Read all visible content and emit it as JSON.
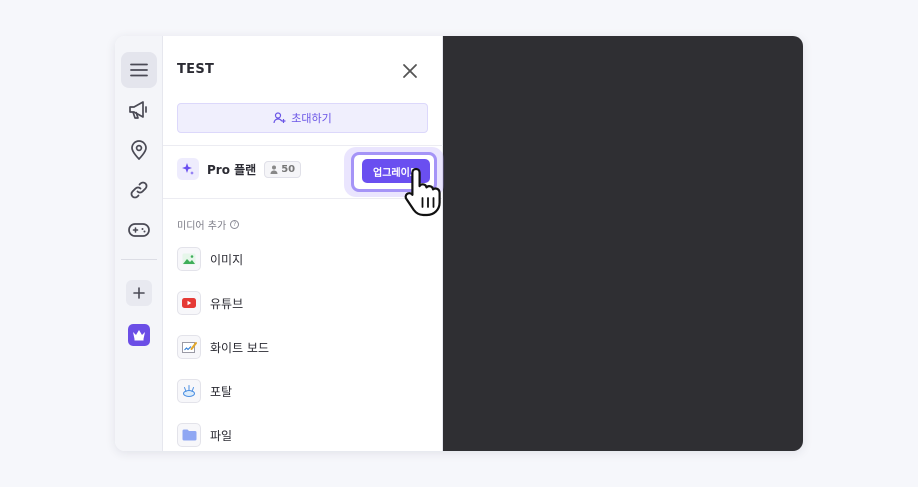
{
  "panel": {
    "title": "TEST",
    "invite_label": "초대하기",
    "plan": {
      "label": "Pro 플랜",
      "member_count": "50",
      "upgrade_label": "업그레이드"
    },
    "media_section_label": "미디어 추가",
    "media_items": [
      {
        "label": "이미지",
        "icon": "image-icon"
      },
      {
        "label": "유튜브",
        "icon": "youtube-icon"
      },
      {
        "label": "화이트 보드",
        "icon": "whiteboard-icon"
      },
      {
        "label": "포탈",
        "icon": "portal-icon"
      },
      {
        "label": "파일",
        "icon": "folder-icon"
      }
    ]
  },
  "rail": {
    "items": [
      "menu-icon",
      "megaphone-icon",
      "location-pin-icon",
      "link-icon",
      "gamepad-icon",
      "plus-icon",
      "crown-icon"
    ]
  },
  "colors": {
    "accent": "#6a4ff0",
    "canvas": "#2f2f33",
    "youtube": "#e53935"
  }
}
